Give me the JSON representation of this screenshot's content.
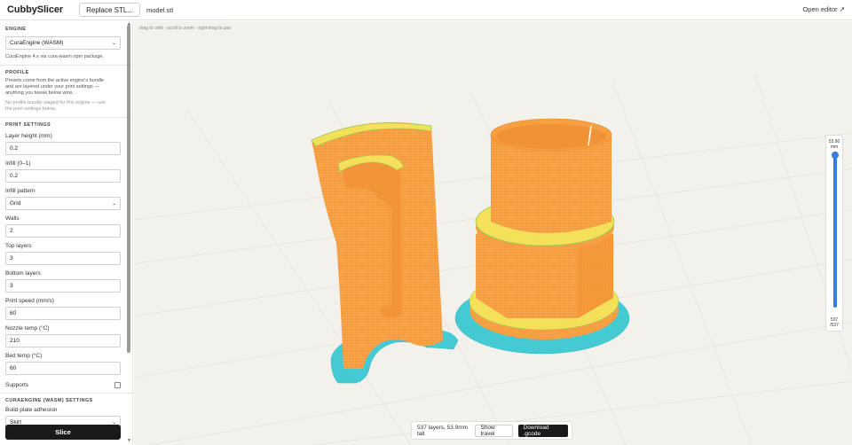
{
  "topbar": {
    "brand": "CubbySlicer",
    "replace_label": "Replace STL...",
    "filename": "model.stl",
    "open_editor": "Open editor ↗"
  },
  "sidebar": {
    "engine_title": "ENGINE",
    "engine_value": "CuraEngine (WASM)",
    "engine_hint": "CuraEngine 4.x via cura-wasm npm package.",
    "profile_title": "PROFILE",
    "profile_hint_1": "Presets come from the active engine's bundle",
    "profile_hint_2": "and are layered under your print settings —",
    "profile_hint_3": "anything you tweak below wins.",
    "profile_muted_1": "No profile bundle staged for this engine — use",
    "profile_muted_2": "the print settings below.",
    "print_title": "PRINT SETTINGS",
    "fields": [
      {
        "label": "Layer height (mm)",
        "value": "0.2"
      },
      {
        "label": "Infill (0–1)",
        "value": "0.2"
      }
    ],
    "infill_pattern_label": "Infill pattern",
    "infill_pattern_value": "Grid",
    "fields2": [
      {
        "label": "Walls",
        "value": "2"
      },
      {
        "label": "Top layers",
        "value": "3"
      },
      {
        "label": "Bottom layers",
        "value": "3"
      },
      {
        "label": "Print speed (mm/s)",
        "value": "60"
      },
      {
        "label": "Nozzle temp (°C)",
        "value": "210"
      },
      {
        "label": "Bed temp (°C)",
        "value": "60"
      }
    ],
    "supports_label": "Supports",
    "cura_title": "CURAENGINE (WASM) SETTINGS",
    "adhesion_label": "Build plate adhesion",
    "adhesion_value": "Skirt",
    "slice_label": "Slice"
  },
  "viewport": {
    "hint": "drag to orbit · scroll to zoom · right-drag to pan"
  },
  "layer_slider": {
    "top_value": "53.90",
    "top_unit": "mm",
    "bottom_1": "537",
    "bottom_2": "/537",
    "fraction": 1.0
  },
  "bottom_bar": {
    "status": "537 layers, 53.9mm tall",
    "show_travel": "Show travel",
    "download": "Download .gcode"
  },
  "colors": {
    "wall": "#f7a043",
    "skin": "#f5e05a",
    "skirt": "#4dd4dc",
    "accent": "#3a7be8"
  }
}
